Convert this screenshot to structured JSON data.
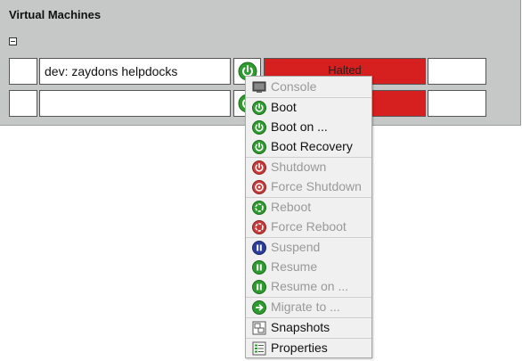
{
  "panel": {
    "title": "Virtual Machines"
  },
  "vms": [
    {
      "name": "dev: zaydons helpdocks",
      "state": "Halted"
    },
    {
      "name": "",
      "state": ""
    }
  ],
  "menu": {
    "items": [
      {
        "label": "Console",
        "icon": "console-icon",
        "enabled": false
      },
      {
        "label": "Boot",
        "icon": "power-green-icon",
        "enabled": true
      },
      {
        "label": "Boot on ...",
        "icon": "power-green-icon",
        "enabled": true
      },
      {
        "label": "Boot Recovery",
        "icon": "power-green-icon",
        "enabled": true
      },
      {
        "label": "Shutdown",
        "icon": "power-red-icon",
        "enabled": false
      },
      {
        "label": "Force Shutdown",
        "icon": "power-red-icon",
        "enabled": false
      },
      {
        "label": "Reboot",
        "icon": "reboot-green-icon",
        "enabled": false
      },
      {
        "label": "Force Reboot",
        "icon": "reboot-red-icon",
        "enabled": false
      },
      {
        "label": "Suspend",
        "icon": "pause-blue-icon",
        "enabled": false
      },
      {
        "label": "Resume",
        "icon": "play-green-icon",
        "enabled": false
      },
      {
        "label": "Resume on ...",
        "icon": "play-green-icon",
        "enabled": false
      },
      {
        "label": "Migrate to ...",
        "icon": "arrow-green-icon",
        "enabled": false
      },
      {
        "label": "Snapshots",
        "icon": "snapshots-icon",
        "enabled": true
      },
      {
        "label": "Properties",
        "icon": "properties-icon",
        "enabled": true
      }
    ]
  },
  "colors": {
    "panel_bg": "#c5c8c6",
    "halted_red": "#d61f1f",
    "menu_bg": "#f0f0f0",
    "disabled_text": "#999999",
    "power_green": "#2e9b2e"
  }
}
